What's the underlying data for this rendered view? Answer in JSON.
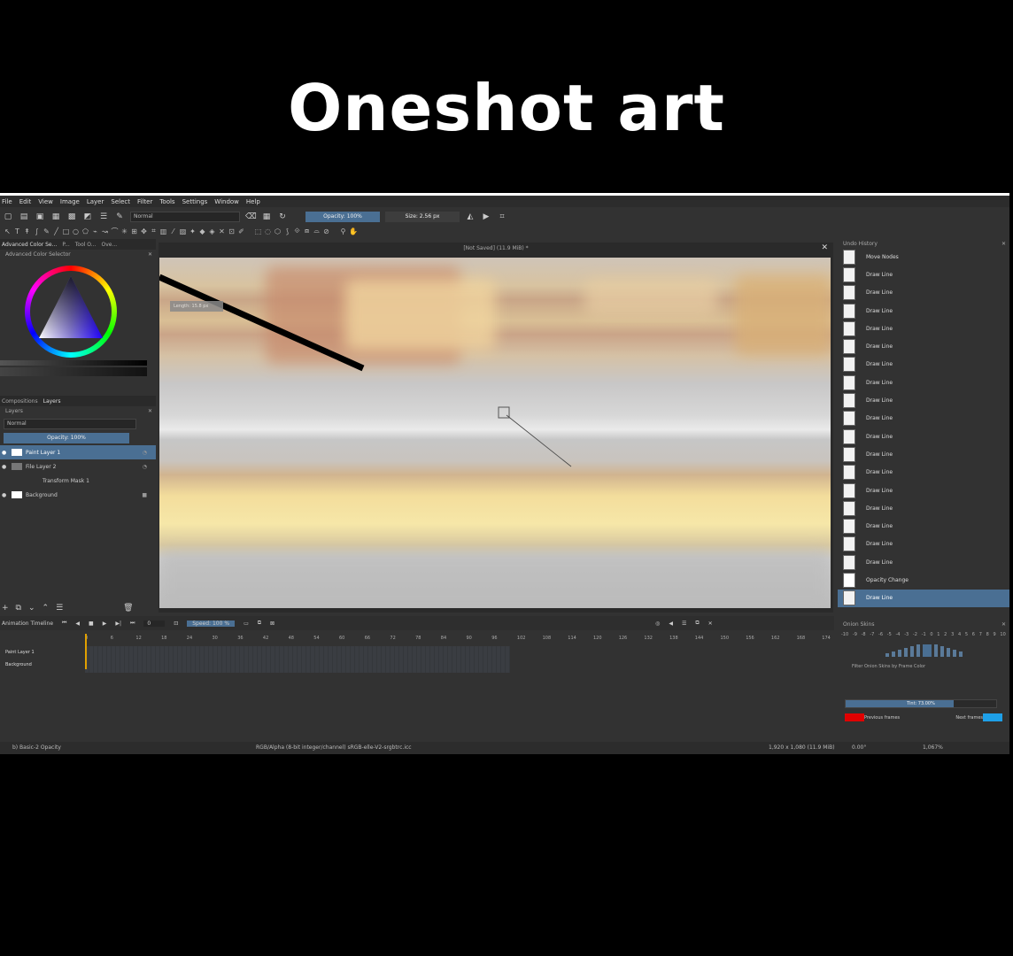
{
  "title": "Oneshot art",
  "menu": [
    "File",
    "Edit",
    "View",
    "Image",
    "Layer",
    "Select",
    "Filter",
    "Tools",
    "Settings",
    "Window",
    "Help"
  ],
  "toolbar": {
    "blend_mode": "Normal",
    "opacity": "Opacity: 100%",
    "size": "Size: 2.56 px"
  },
  "left_dock": {
    "tabs": [
      "Advanced Color Se...",
      "P...",
      "Tool O...",
      "Ove..."
    ],
    "color_selector_title": "Advanced Color Selector",
    "layer_tabs": [
      "Compositions",
      "Layers"
    ],
    "layers_title": "Layers",
    "blend": "Normal",
    "opacity": "Opacity:  100%",
    "layers": [
      "Paint Layer 1",
      "File Layer 2",
      "Transform Mask 1",
      "Background"
    ]
  },
  "document": {
    "title": "[Not Saved]  (11.9 MiB) *",
    "length_label": "Length: 15.8 px"
  },
  "undo_history": {
    "title": "Undo History",
    "items": [
      "Move Nodes",
      "Draw Line",
      "Draw Line",
      "Draw Line",
      "Draw Line",
      "Draw Line",
      "Draw Line",
      "Draw Line",
      "Draw Line",
      "Draw Line",
      "Draw Line",
      "Draw Line",
      "Draw Line",
      "Draw Line",
      "Draw Line",
      "Draw Line",
      "Draw Line",
      "Draw Line",
      "Opacity Change",
      "Draw Line"
    ]
  },
  "onion": {
    "title": "Onion Skins",
    "scale": [
      "-10",
      "-9",
      "-8",
      "-7",
      "-6",
      "-5",
      "-4",
      "-3",
      "-2",
      "-1",
      "0",
      "1",
      "2",
      "3",
      "4",
      "5",
      "6",
      "7",
      "8",
      "9",
      "10"
    ],
    "filter_label": "Filter Onion Skins by Frame Color",
    "tint": "Tint: 73.00%",
    "prev": "Previous frames",
    "next": "Next frames",
    "prev_color": "#e00000",
    "next_color": "#1ea0e8"
  },
  "timeline": {
    "title": "Animation Timeline",
    "frame": "0",
    "speed": "Speed: 100 %",
    "ruler": [
      "0",
      "6",
      "12",
      "18",
      "24",
      "30",
      "36",
      "42",
      "48",
      "54",
      "60",
      "66",
      "72",
      "78",
      "84",
      "90",
      "96",
      "102",
      "108",
      "114",
      "120",
      "126",
      "132",
      "138",
      "144",
      "150",
      "156",
      "162",
      "168",
      "174"
    ],
    "rows": [
      "Paint Layer 1",
      "Background"
    ]
  },
  "status": {
    "left": "b) Basic-2 Opacity",
    "color": "RGB/Alpha (8-bit integer/channel)  sRGB-elle-V2-srgbtrc.icc",
    "size": "1,920 x 1,080 (11.9 MiB)",
    "rotation": "0.00°",
    "zoom": "1,067%"
  }
}
